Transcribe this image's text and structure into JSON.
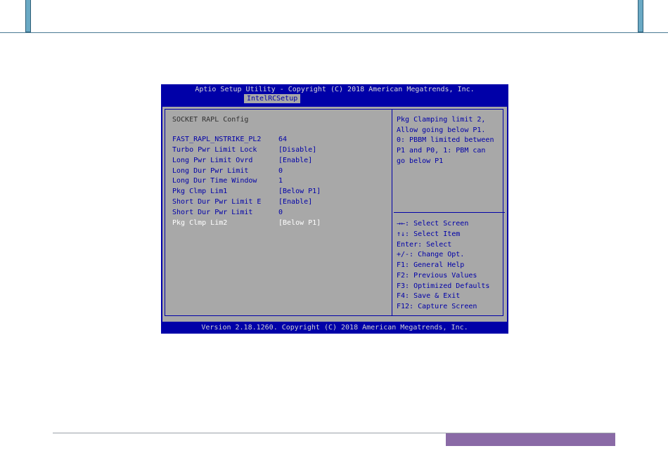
{
  "bios": {
    "title": "Aptio Setup Utility - Copyright (C) 2018 American Megatrends, Inc.",
    "active_tab": "IntelRCSetup",
    "section_title": "SOCKET RAPL Config",
    "settings": [
      {
        "label": "FAST_RAPL_NSTRIKE_PL2",
        "value": "64"
      },
      {
        "label": "Turbo Pwr Limit Lock",
        "value": "[Disable]"
      },
      {
        "label": "Long Pwr Limit Ovrd",
        "value": "[Enable]"
      },
      {
        "label": "Long Dur Pwr Limit",
        "value": "0"
      },
      {
        "label": "Long Dur Time Window",
        "value": "1"
      },
      {
        "label": "Pkg Clmp Lim1",
        "value": "[Below P1]"
      },
      {
        "label": "Short Dur Pwr Limit E",
        "value": "[Enable]"
      },
      {
        "label": "Short Dur Pwr Limit",
        "value": "0"
      },
      {
        "label": "Pkg Clmp Lim2",
        "value": "[Below P1]"
      }
    ],
    "help_text": [
      "Pkg Clamping limit 2,",
      "Allow going below P1.",
      "0: PBBM limited between",
      "P1 and P0, 1: PBM can",
      "go below P1"
    ],
    "key_help": [
      "→←: Select Screen",
      "↑↓: Select Item",
      "Enter: Select",
      "+/-: Change Opt.",
      "F1: General Help",
      "F2: Previous Values",
      "F3: Optimized Defaults",
      "F4: Save & Exit",
      "F12: Capture Screen"
    ],
    "footer": "Version 2.18.1260. Copyright (C) 2018 American Megatrends, Inc."
  },
  "colors": {
    "bios_blue": "#0000a8",
    "bios_gray": "#a8a8a8",
    "header_accent": "#6aa9c4",
    "footer_accent": "#8a6aa6"
  }
}
